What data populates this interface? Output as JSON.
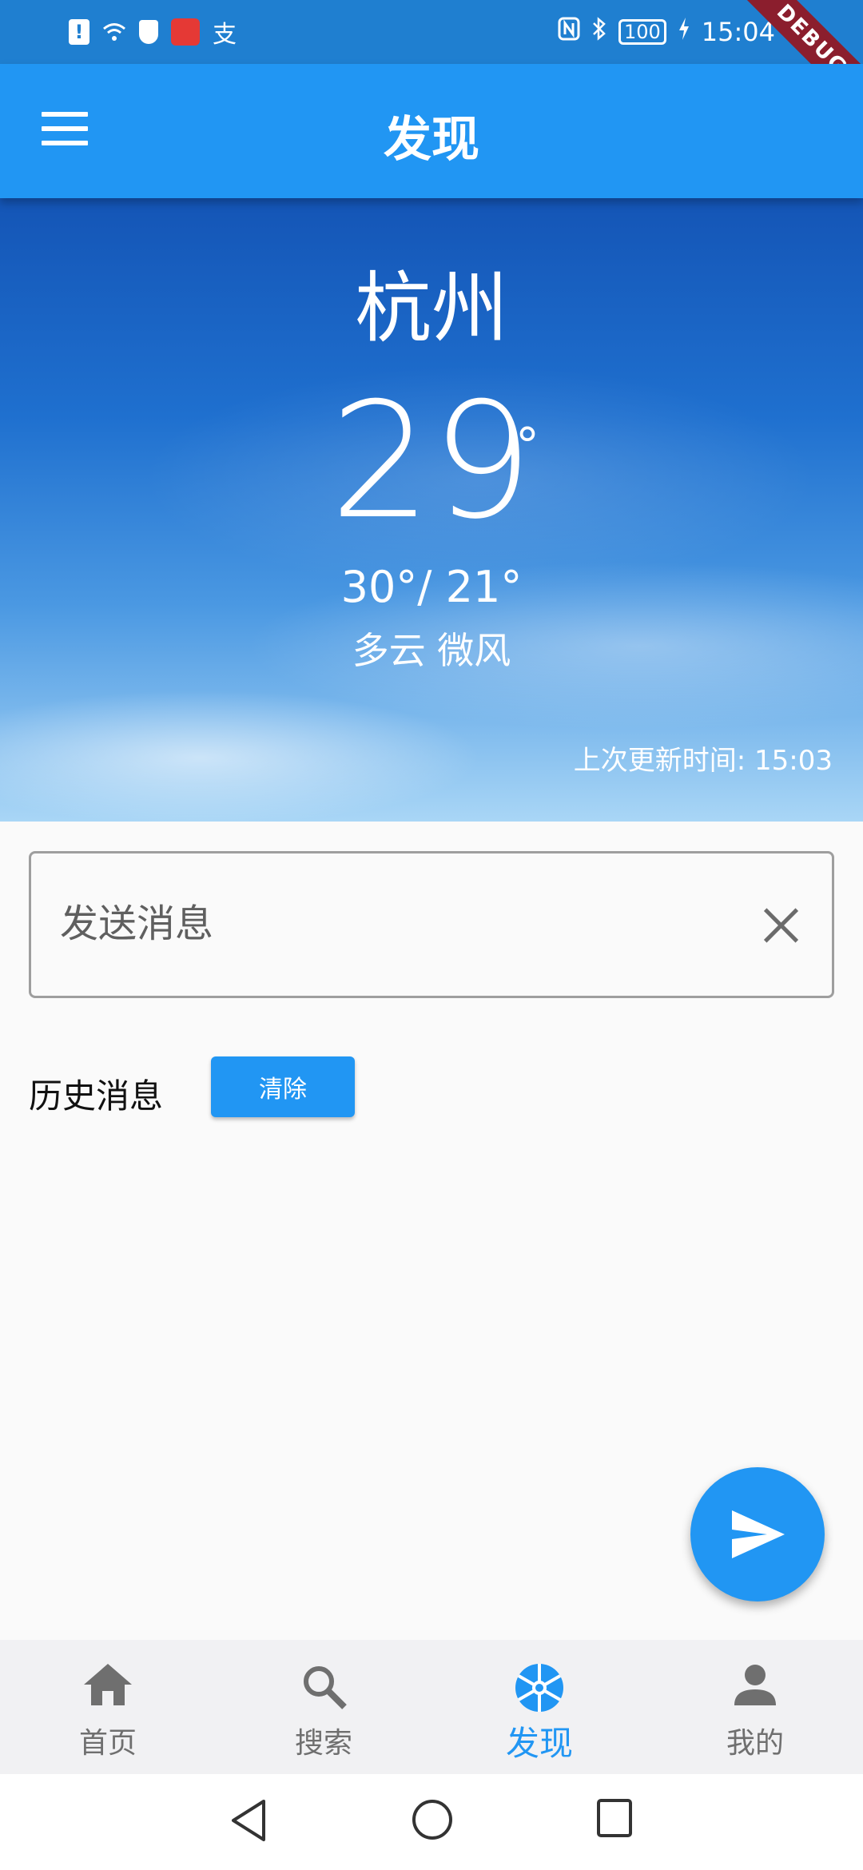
{
  "status_bar": {
    "time": "15:04",
    "battery": "100",
    "left_icons": [
      "alert-icon",
      "wifi-icon",
      "shield-icon",
      "app-icon",
      "alipay-icon"
    ],
    "alipay_glyph": "支",
    "right_icons": [
      "nfc-icon",
      "bluetooth-icon",
      "battery-icon",
      "charging-icon"
    ]
  },
  "debug_banner": "DEBUG",
  "app_bar": {
    "title": "发现",
    "menu_icon": "menu-icon"
  },
  "weather": {
    "city": "杭州",
    "temperature": "29",
    "degree_symbol": "°",
    "range": "30°/ 21°",
    "description": "多云 微风",
    "updated": "上次更新时间: 15:03"
  },
  "message_input": {
    "placeholder": "发送消息",
    "value": ""
  },
  "history": {
    "label": "历史消息",
    "clear_button": "清除",
    "items": []
  },
  "fab": {
    "icon": "send-icon"
  },
  "bottom_nav": {
    "items": [
      {
        "label": "首页",
        "icon": "home-icon",
        "active": false
      },
      {
        "label": "搜索",
        "icon": "search-icon",
        "active": false
      },
      {
        "label": "发现",
        "icon": "discover-icon",
        "active": true
      },
      {
        "label": "我的",
        "icon": "person-icon",
        "active": false
      }
    ]
  },
  "colors": {
    "primary": "#2196f3",
    "status_bar": "#1f7fd0",
    "debug": "#8b1e2d",
    "inactive": "#6f6f6f"
  }
}
